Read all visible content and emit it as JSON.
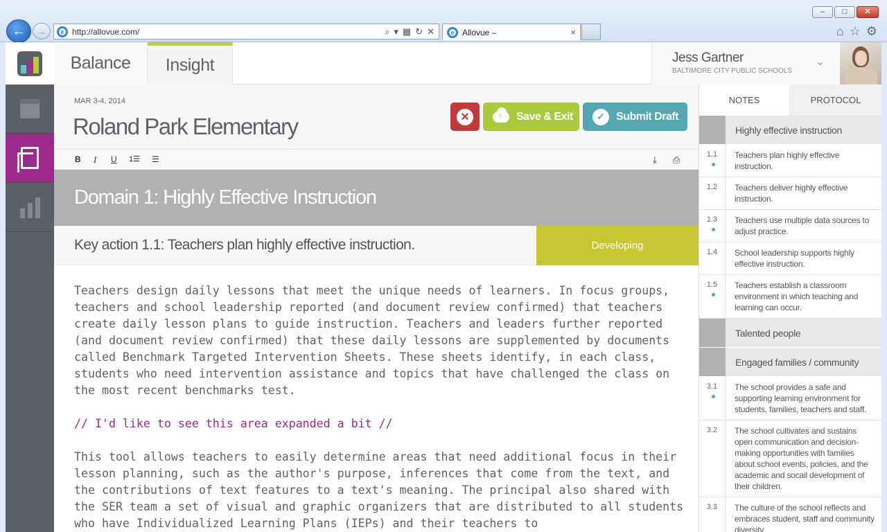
{
  "browser": {
    "url": "http://allovue.com/",
    "tab_title": "Allovue –",
    "tab_close": "×"
  },
  "nav": {
    "tabs": [
      {
        "label": "Balance"
      },
      {
        "label": "Insight"
      }
    ]
  },
  "user": {
    "name": "Jess Gartner",
    "organization": "BALTIMORE CITY PUBLIC SCHOOLS"
  },
  "header": {
    "date": "MAR 3-4, 2014",
    "school": "Roland Park Elementary",
    "save_label": "Save & Exit",
    "submit_label": "Submit Draft"
  },
  "toolbar": {
    "bold": "B",
    "italic": "I",
    "underline": "U"
  },
  "domain": {
    "title": "Domain 1: Highly Effective Instruction"
  },
  "key_action": {
    "title": "Key action 1.1: Teachers plan highly effective instruction.",
    "rating": "Developing"
  },
  "body": {
    "paragraph1": "Teachers design daily lessons that meet the unique needs of learners. In focus groups, teachers and school leadership reported (and document review confirmed) that teachers create daily lesson plans to guide instruction. Teachers and leaders further reported (and document review confirmed) that these daily lessons are supplemented by documents called Benchmark Targeted Intervention Sheets. These sheets identify, in each class, students who need intervention assistance and topics that have challenged the class on the most recent benchmarks test.",
    "comment": "// I'd like to see this area expanded a bit //",
    "paragraph2": "This tool allows teachers to easily determine areas that need additional focus in their lesson planning, such as the author's purpose, inferences that come from the text, and the contributions of text features to a text's meaning. The principal also shared with the SER team a set of visual and graphic organizers that are distributed to all students who have Individualized Learning Plans (IEPs) and their teachers to"
  },
  "side": {
    "tab_notes": "NOTES",
    "tab_protocol": "PROTOCOL",
    "sections": [
      {
        "label": "Highly effective instruction",
        "items": [
          {
            "num": "1.1",
            "text": "Teachers plan highly effective instruction.",
            "dot": true
          },
          {
            "num": "1.2",
            "text": "Teachers deliver highly effective instruction.",
            "dot": false
          },
          {
            "num": "1.3",
            "text": "Teachers use multiple data sources to adjust practice.",
            "dot": true
          },
          {
            "num": "1.4",
            "text": "School leadership supports highly effective instruction.",
            "dot": false
          },
          {
            "num": "1.5",
            "text": "Teachers establish a classroom environment in which teaching and learning can occur.",
            "dot": true
          }
        ]
      },
      {
        "label": "Talented people",
        "items": []
      },
      {
        "label": "Engaged families / community",
        "items": [
          {
            "num": "3.1",
            "text": "The school provides a safe and supporting learning environment for students, families, teachers and staff.",
            "dot": true
          },
          {
            "num": "3.2",
            "text": "The school cultivates and sustains open communication and decision-making opportunities with families about school events, policies, and the academic and socail development of their children.",
            "dot": false
          },
          {
            "num": "3.3",
            "text": "The culture of the school reflects and embraces student, staff and community diversity.",
            "dot": false
          }
        ]
      }
    ]
  },
  "colors": {
    "accent_green": "#a9ca3c",
    "accent_teal": "#52a7b3",
    "accent_red": "#c0393b",
    "accent_purple": "#9b2a8c",
    "rating_yellow": "#c5c631"
  }
}
